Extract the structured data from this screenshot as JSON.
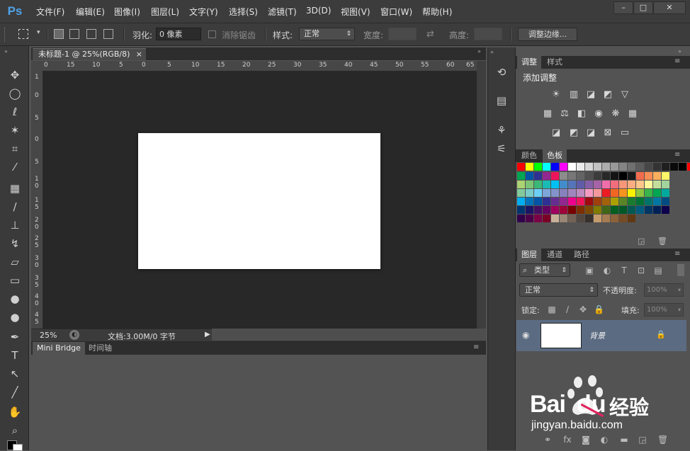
{
  "app": {
    "logo": "Ps"
  },
  "menu": [
    "文件(F)",
    "编辑(E)",
    "图像(I)",
    "图层(L)",
    "文字(Y)",
    "选择(S)",
    "滤镜(T)",
    "3D(D)",
    "视图(V)",
    "窗口(W)",
    "帮助(H)"
  ],
  "window_controls": {
    "minimize": "–",
    "maximize": "□",
    "close": "✕"
  },
  "options": {
    "feather_label": "羽化:",
    "feather_value": "0 像素",
    "antialias_label": "消除锯齿",
    "style_label": "样式:",
    "style_value": "正常",
    "width_label": "宽度:",
    "height_label": "高度:",
    "refine_edge_button": "调整边缘..."
  },
  "document": {
    "tab_title": "未标题-1 @ 25%(RGB/8)",
    "tab_close": "×",
    "zoom": "25%",
    "doc_info": "文档:3.00M/0 字节",
    "ruler_top_ticks": [
      "0",
      "15",
      "10",
      "5",
      "0",
      "5",
      "10",
      "15",
      "20",
      "25",
      "30",
      "35",
      "40",
      "45",
      "50",
      "55",
      "60",
      "65"
    ],
    "ruler_left_ticks": [
      "1",
      "0",
      "5",
      "0",
      "5",
      "1\n0",
      "1\n5",
      "2\n0",
      "2\n5",
      "3\n0",
      "3\n5",
      "4\n0",
      "4\n5"
    ]
  },
  "bottom_panel": {
    "tabs": [
      "Mini Bridge",
      "时间轴"
    ]
  },
  "adjustments_panel": {
    "tabs": [
      "调整",
      "样式"
    ],
    "heading": "添加调整"
  },
  "swatches_panel": {
    "tabs": [
      "颜色",
      "色板"
    ],
    "colors": [
      [
        "#ff0000",
        "#ffff00",
        "#00ff00",
        "#00ffff",
        "#0000ff",
        "#ff00ff",
        "#ffffff",
        "#ebebeb",
        "#d6d6d6",
        "#c2c2c2",
        "#adadad",
        "#999999",
        "#858585",
        "#707070",
        "#5c5c5c",
        "#474747",
        "#333333",
        "#1f1f1f",
        "#0a0a0a",
        "#000000",
        "#ff0000",
        "#ffff00"
      ],
      [
        "#00a651",
        "#0054a6",
        "#2e3192",
        "#92278f",
        "#ed145b",
        "#8c8c8c",
        "#787878",
        "#646464",
        "#505050",
        "#3c3c3c",
        "#282828",
        "#141414",
        "#000000",
        "#1a1a1a",
        "#f26c4f",
        "#f68e56",
        "#fbaf5d",
        "#fff568"
      ],
      [
        "#acd373",
        "#7cc576",
        "#3bb878",
        "#1abbb4",
        "#00bff3",
        "#438ccb",
        "#5574b9",
        "#605ca8",
        "#855fa8",
        "#a763a8",
        "#f06eaa",
        "#f26d7d",
        "#f7977a",
        "#f9ad81",
        "#fdc68a",
        "#fff79a",
        "#c4df9b",
        "#a3d39c"
      ],
      [
        "#82ca9c",
        "#7accc8",
        "#6dcff6",
        "#7da7d9",
        "#8393ca",
        "#8781bd",
        "#a186be",
        "#bd8cbf",
        "#f49ac1",
        "#f5989d",
        "#ed1c24",
        "#f26522",
        "#f7941d",
        "#fff200",
        "#8dc63f",
        "#39b54a",
        "#00a651",
        "#00a99d"
      ],
      [
        "#00aeef",
        "#0072bc",
        "#0054a6",
        "#2e3192",
        "#662d91",
        "#92278f",
        "#ec008c",
        "#ed145b",
        "#9e0b0f",
        "#a0410d",
        "#a36209",
        "#aba000",
        "#598527",
        "#1a7b30",
        "#007236",
        "#00746b",
        "#0076a3",
        "#004b80"
      ],
      [
        "#003471",
        "#1b1464",
        "#440e62",
        "#630460",
        "#9e005d",
        "#9e0039",
        "#790000",
        "#7b2e00",
        "#7d4900",
        "#827b00",
        "#406618",
        "#005e20",
        "#005826",
        "#005952",
        "#005b7f",
        "#003663",
        "#002157",
        "#0d004c"
      ],
      [
        "#32004b",
        "#4b0049",
        "#7b0046",
        "#7a0026",
        "#c7b299",
        "#998675",
        "#736357",
        "#534741",
        "#37302d",
        "#c69c6d",
        "#a67c52",
        "#8c6239",
        "#754c24",
        "#603913"
      ]
    ]
  },
  "layers_panel": {
    "tabs": [
      "图层",
      "通道",
      "路径"
    ],
    "filter_kind": "类型",
    "blend_mode": "正常",
    "opacity_label": "不透明度:",
    "opacity_value": "100%",
    "lock_label": "锁定:",
    "fill_label": "填充:",
    "fill_value": "100%",
    "layer_name": "背景"
  },
  "watermark": {
    "brand_left": "Bai",
    "brand_right": "du",
    "brand_cn": "经验",
    "url": "jingyan.baidu.com"
  }
}
